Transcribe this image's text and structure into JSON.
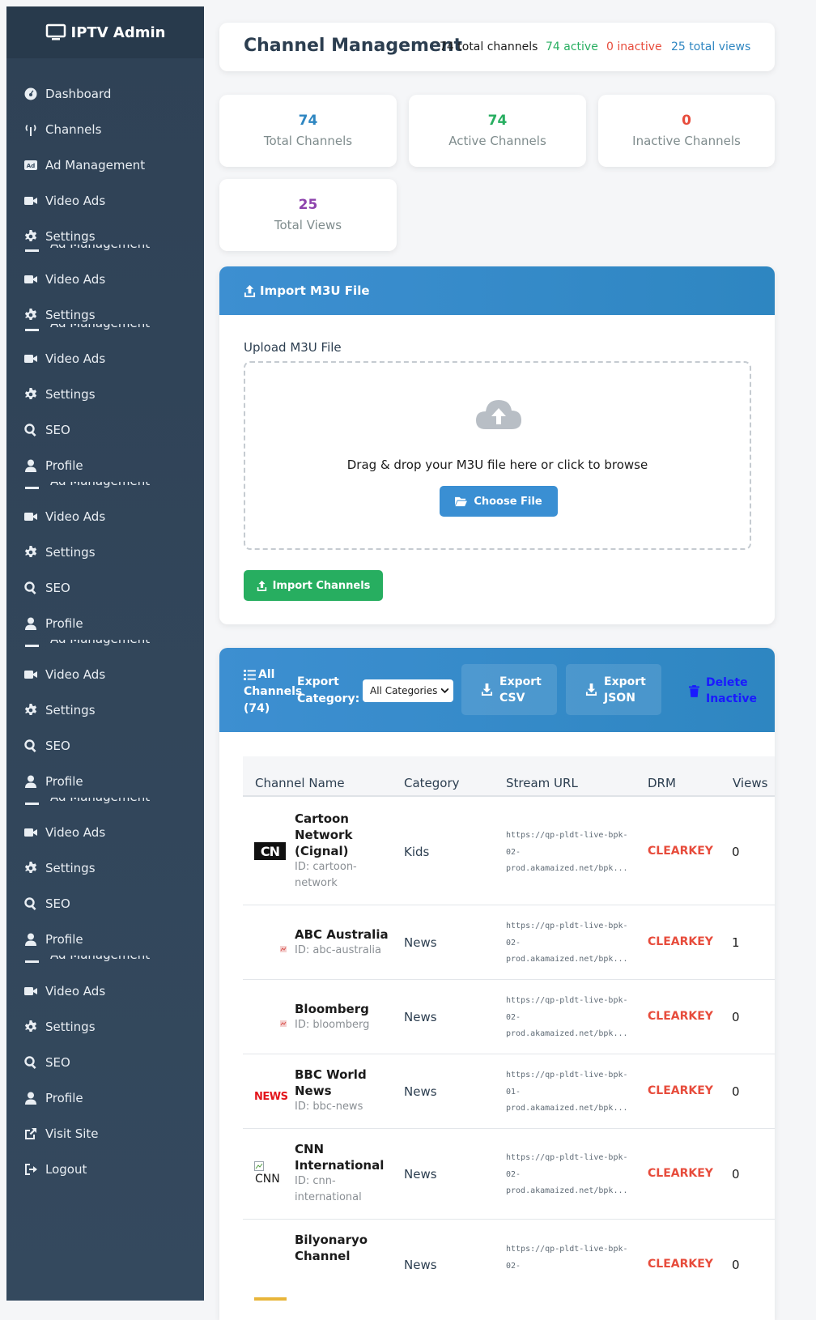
{
  "sidebar": {
    "brand": "IPTV Admin",
    "items": {
      "dashboard": "Dashboard",
      "channels": "Channels",
      "ad_management": "Ad Management",
      "video_ads": "Video Ads",
      "settings": "Settings",
      "seo": "SEO",
      "profile": "Profile",
      "visit_site": "Visit Site",
      "logout": "Logout"
    }
  },
  "header": {
    "title": "Channel Management",
    "total": "74 total channels",
    "active": "74 active",
    "inactive": "0 inactive",
    "views": "25 total views"
  },
  "stats": [
    {
      "value": "74",
      "label": "Total Channels",
      "color": "#2e86c1"
    },
    {
      "value": "74",
      "label": "Active Channels",
      "color": "#27ae60"
    },
    {
      "value": "0",
      "label": "Inactive Channels",
      "color": "#e74c3c"
    },
    {
      "value": "25",
      "label": "Total Views",
      "color": "#8e44ad"
    }
  ],
  "import": {
    "title": "Import M3U File",
    "upload_label": "Upload M3U File",
    "drop_text": "Drag & drop your M3U file here or click to browse",
    "choose_button": "Choose File",
    "import_button": "Import Channels"
  },
  "channels_panel": {
    "title_line1": "All",
    "title_line2": "Channels",
    "title_line3": "(74)",
    "export_label_line1": "Export",
    "export_label_line2": "Category:",
    "category_select": "All Categories",
    "export_csv_line1": "Export",
    "export_csv_line2": "CSV",
    "export_json_line1": "Export",
    "export_json_line2": "JSON",
    "delete_line1": "Delete",
    "delete_line2": "Inactive"
  },
  "table": {
    "headers": [
      "Channel Name",
      "Category",
      "Stream URL",
      "DRM",
      "Views"
    ],
    "rows": [
      {
        "name1": "Cartoon",
        "name2": "Network",
        "name3": "(Cignal)",
        "id1": "ID: cartoon-",
        "id2": "network",
        "category": "Kids",
        "url1": "https://qp-pldt-live-bpk-",
        "url2": "02-",
        "url3": "prod.akamaized.net/bpk...",
        "drm": "CLEARKEY",
        "views": "0",
        "logo": "CN"
      },
      {
        "name1": "ABC Australia",
        "id1": "ID: abc-australia",
        "category": "News",
        "url1": "https://qp-pldt-live-bpk-",
        "url2": "02-",
        "url3": "prod.akamaized.net/bpk...",
        "drm": "CLEARKEY",
        "views": "1"
      },
      {
        "name1": "Bloomberg",
        "id1": "ID: bloomberg",
        "category": "News",
        "url1": "https://qp-pldt-live-bpk-",
        "url2": "02-",
        "url3": "prod.akamaized.net/bpk...",
        "drm": "CLEARKEY",
        "views": "0"
      },
      {
        "name1": "BBC World",
        "name2": "News",
        "id1": "ID: bbc-news",
        "category": "News",
        "url1": "https://qp-pldt-live-bpk-",
        "url2": "01-",
        "url3": "prod.akamaized.net/bpk...",
        "drm": "CLEARKEY",
        "views": "0",
        "logo": "NEWS"
      },
      {
        "name1": "CNN",
        "name2": "International",
        "id1": "ID: cnn-",
        "id2": "international",
        "category": "News",
        "url1": "https://qp-pldt-live-bpk-",
        "url2": "02-",
        "url3": "prod.akamaized.net/bpk...",
        "drm": "CLEARKEY",
        "views": "0",
        "logo": "CNN"
      },
      {
        "name1": "Bilyonaryo",
        "name2": "Channel",
        "category": "News",
        "url1": "https://qp-pldt-live-bpk-",
        "url2": "02-",
        "drm": "CLEARKEY",
        "views": "0"
      }
    ]
  }
}
